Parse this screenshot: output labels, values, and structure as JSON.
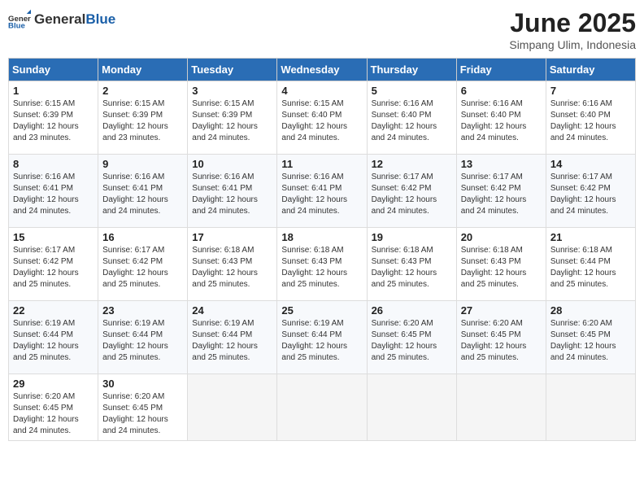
{
  "header": {
    "logo_general": "General",
    "logo_blue": "Blue",
    "month": "June 2025",
    "location": "Simpang Ulim, Indonesia"
  },
  "weekdays": [
    "Sunday",
    "Monday",
    "Tuesday",
    "Wednesday",
    "Thursday",
    "Friday",
    "Saturday"
  ],
  "weeks": [
    [
      {
        "day": "1",
        "sunrise": "6:15 AM",
        "sunset": "6:39 PM",
        "daylight": "12 hours and 23 minutes."
      },
      {
        "day": "2",
        "sunrise": "6:15 AM",
        "sunset": "6:39 PM",
        "daylight": "12 hours and 23 minutes."
      },
      {
        "day": "3",
        "sunrise": "6:15 AM",
        "sunset": "6:39 PM",
        "daylight": "12 hours and 24 minutes."
      },
      {
        "day": "4",
        "sunrise": "6:15 AM",
        "sunset": "6:40 PM",
        "daylight": "12 hours and 24 minutes."
      },
      {
        "day": "5",
        "sunrise": "6:16 AM",
        "sunset": "6:40 PM",
        "daylight": "12 hours and 24 minutes."
      },
      {
        "day": "6",
        "sunrise": "6:16 AM",
        "sunset": "6:40 PM",
        "daylight": "12 hours and 24 minutes."
      },
      {
        "day": "7",
        "sunrise": "6:16 AM",
        "sunset": "6:40 PM",
        "daylight": "12 hours and 24 minutes."
      }
    ],
    [
      {
        "day": "8",
        "sunrise": "6:16 AM",
        "sunset": "6:41 PM",
        "daylight": "12 hours and 24 minutes."
      },
      {
        "day": "9",
        "sunrise": "6:16 AM",
        "sunset": "6:41 PM",
        "daylight": "12 hours and 24 minutes."
      },
      {
        "day": "10",
        "sunrise": "6:16 AM",
        "sunset": "6:41 PM",
        "daylight": "12 hours and 24 minutes."
      },
      {
        "day": "11",
        "sunrise": "6:16 AM",
        "sunset": "6:41 PM",
        "daylight": "12 hours and 24 minutes."
      },
      {
        "day": "12",
        "sunrise": "6:17 AM",
        "sunset": "6:42 PM",
        "daylight": "12 hours and 24 minutes."
      },
      {
        "day": "13",
        "sunrise": "6:17 AM",
        "sunset": "6:42 PM",
        "daylight": "12 hours and 24 minutes."
      },
      {
        "day": "14",
        "sunrise": "6:17 AM",
        "sunset": "6:42 PM",
        "daylight": "12 hours and 24 minutes."
      }
    ],
    [
      {
        "day": "15",
        "sunrise": "6:17 AM",
        "sunset": "6:42 PM",
        "daylight": "12 hours and 25 minutes."
      },
      {
        "day": "16",
        "sunrise": "6:17 AM",
        "sunset": "6:42 PM",
        "daylight": "12 hours and 25 minutes."
      },
      {
        "day": "17",
        "sunrise": "6:18 AM",
        "sunset": "6:43 PM",
        "daylight": "12 hours and 25 minutes."
      },
      {
        "day": "18",
        "sunrise": "6:18 AM",
        "sunset": "6:43 PM",
        "daylight": "12 hours and 25 minutes."
      },
      {
        "day": "19",
        "sunrise": "6:18 AM",
        "sunset": "6:43 PM",
        "daylight": "12 hours and 25 minutes."
      },
      {
        "day": "20",
        "sunrise": "6:18 AM",
        "sunset": "6:43 PM",
        "daylight": "12 hours and 25 minutes."
      },
      {
        "day": "21",
        "sunrise": "6:18 AM",
        "sunset": "6:44 PM",
        "daylight": "12 hours and 25 minutes."
      }
    ],
    [
      {
        "day": "22",
        "sunrise": "6:19 AM",
        "sunset": "6:44 PM",
        "daylight": "12 hours and 25 minutes."
      },
      {
        "day": "23",
        "sunrise": "6:19 AM",
        "sunset": "6:44 PM",
        "daylight": "12 hours and 25 minutes."
      },
      {
        "day": "24",
        "sunrise": "6:19 AM",
        "sunset": "6:44 PM",
        "daylight": "12 hours and 25 minutes."
      },
      {
        "day": "25",
        "sunrise": "6:19 AM",
        "sunset": "6:44 PM",
        "daylight": "12 hours and 25 minutes."
      },
      {
        "day": "26",
        "sunrise": "6:20 AM",
        "sunset": "6:45 PM",
        "daylight": "12 hours and 25 minutes."
      },
      {
        "day": "27",
        "sunrise": "6:20 AM",
        "sunset": "6:45 PM",
        "daylight": "12 hours and 25 minutes."
      },
      {
        "day": "28",
        "sunrise": "6:20 AM",
        "sunset": "6:45 PM",
        "daylight": "12 hours and 24 minutes."
      }
    ],
    [
      {
        "day": "29",
        "sunrise": "6:20 AM",
        "sunset": "6:45 PM",
        "daylight": "12 hours and 24 minutes."
      },
      {
        "day": "30",
        "sunrise": "6:20 AM",
        "sunset": "6:45 PM",
        "daylight": "12 hours and 24 minutes."
      },
      null,
      null,
      null,
      null,
      null
    ]
  ],
  "labels": {
    "sunrise": "Sunrise:",
    "sunset": "Sunset:",
    "daylight": "Daylight:"
  }
}
